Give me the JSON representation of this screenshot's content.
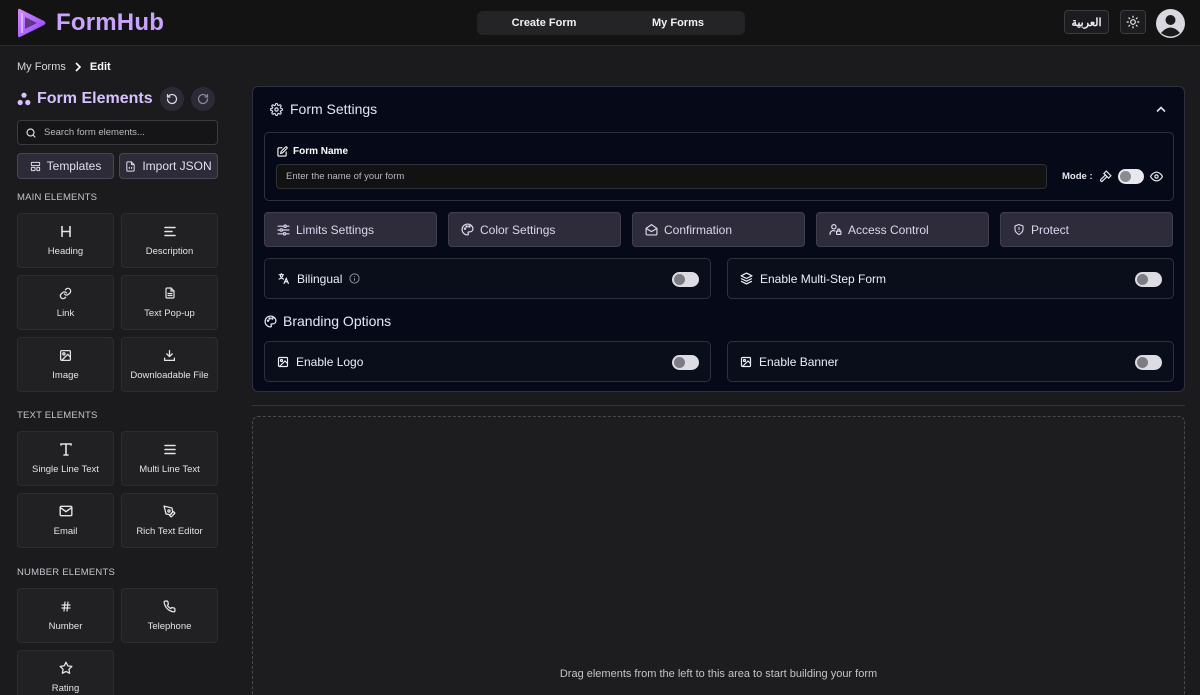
{
  "header": {
    "brand": "FormHub",
    "nav": [
      "Create Form",
      "My Forms"
    ],
    "language_button": "العربية",
    "icons": {
      "theme": "sun-icon",
      "avatar": "user-circle-icon"
    }
  },
  "breadcrumb": {
    "parent": "My Forms",
    "current": "Edit"
  },
  "sidebar": {
    "title": "Form Elements",
    "search_placeholder": "Search form elements...",
    "templates_label": "Templates",
    "import_label": "Import JSON",
    "sections": [
      {
        "label": "MAIN ELEMENTS",
        "items": [
          {
            "label": "Heading",
            "icon": "heading-icon"
          },
          {
            "label": "Description",
            "icon": "align-left-icon"
          },
          {
            "label": "Link",
            "icon": "link-icon"
          },
          {
            "label": "Text Pop-up",
            "icon": "file-text-icon"
          },
          {
            "label": "Image",
            "icon": "image-icon"
          },
          {
            "label": "Downloadable File",
            "icon": "download-icon"
          }
        ]
      },
      {
        "label": "TEXT ELEMENTS",
        "items": [
          {
            "label": "Single Line Text",
            "icon": "type-icon"
          },
          {
            "label": "Multi Line Text",
            "icon": "menu-lines-icon"
          },
          {
            "label": "Email",
            "icon": "mail-icon"
          },
          {
            "label": "Rich Text Editor",
            "icon": "pen-tool-icon"
          }
        ]
      },
      {
        "label": "NUMBER ELEMENTS",
        "items": [
          {
            "label": "Number",
            "icon": "hash-icon"
          },
          {
            "label": "Telephone",
            "icon": "phone-icon"
          },
          {
            "label": "Rating",
            "icon": "star-icon"
          }
        ]
      }
    ]
  },
  "settings": {
    "title": "Form Settings",
    "form_name_label": "Form Name",
    "form_name_placeholder": "Enter the name of your form",
    "form_name_value": "",
    "mode_label": "Mode :",
    "buttons": [
      "Limits Settings",
      "Color Settings",
      "Confirmation",
      "Access Control",
      "Protect"
    ],
    "bilingual_label": "Bilingual",
    "multistep_label": "Enable Multi-Step Form",
    "branding_title": "Branding Options",
    "logo_label": "Enable Logo",
    "banner_label": "Enable Banner",
    "toggles": {
      "mode_preview": false,
      "bilingual": false,
      "multistep": false,
      "logo": false,
      "banner": false
    }
  },
  "canvas": {
    "hint": "Drag elements from the left to this area to start building your form"
  },
  "colors": {
    "accent": "#c9a4ff",
    "panel": "#060917",
    "background": "#1b1b1d"
  }
}
